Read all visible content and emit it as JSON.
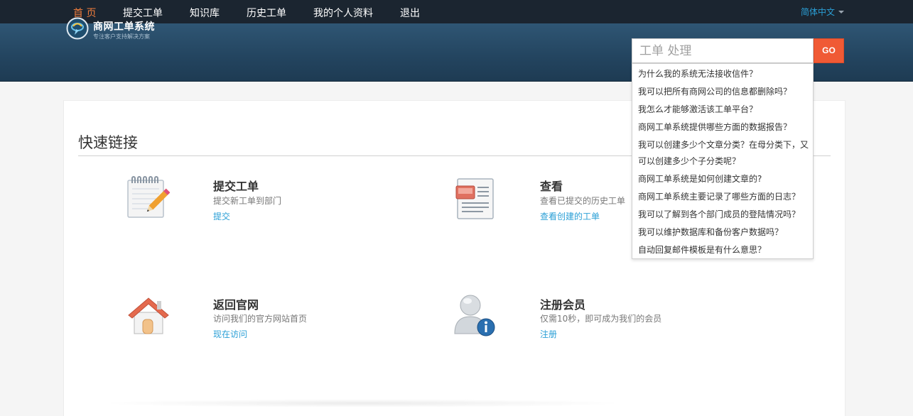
{
  "nav": {
    "items": [
      "首 页",
      "提交工单",
      "知识库",
      "历史工单",
      "我的个人资料",
      "退出"
    ],
    "language": "简体中文"
  },
  "header": {
    "brand": "商网工单系统",
    "slogan": "专注客户支持解决方案"
  },
  "search": {
    "placeholder": "工单 处理",
    "button": "GO",
    "suggestions": [
      "为什么我的系统无法接收信件？",
      "我可以把所有商网公司的信息都删除吗？",
      "我怎么才能够激活该工单平台？",
      "商网工单系统提供哪些方面的数据报告？",
      "我可以创建多少个文章分类？在母分类下，又",
      "可以创建多少个子分类呢？",
      "商网工单系统是如何创建文章的?",
      "商网工单系统主要记录了哪些方面的日志？",
      "我可以了解到各个部门成员的登陆情况吗？",
      "我可以维护数据库和备份客户数据吗？",
      "自动回复邮件模板是有什么意思？"
    ]
  },
  "quick_links": {
    "title": "快速链接",
    "items": [
      {
        "icon": "notepad-pencil-icon",
        "title": "提交工单",
        "desc": "提交新工单到部门",
        "link": "提交"
      },
      {
        "icon": "document-view-icon",
        "title": "查看",
        "desc": "查看已提交的历史工单",
        "link": "查看创建的工单"
      },
      {
        "icon": "home-icon",
        "title": "返回官网",
        "desc": "访问我们的官方网站首页",
        "link": "现在访问"
      },
      {
        "icon": "user-info-icon",
        "title": "注册会员",
        "desc": "仅需10秒，即可成为我们的会员",
        "link": "注册"
      }
    ]
  },
  "colors": {
    "nav_bg": "#1b2530",
    "nav_active": "#f07d3c",
    "banner": "#2f5674",
    "accent_link": "#2a9fd6",
    "go_button": "#f05a35"
  }
}
